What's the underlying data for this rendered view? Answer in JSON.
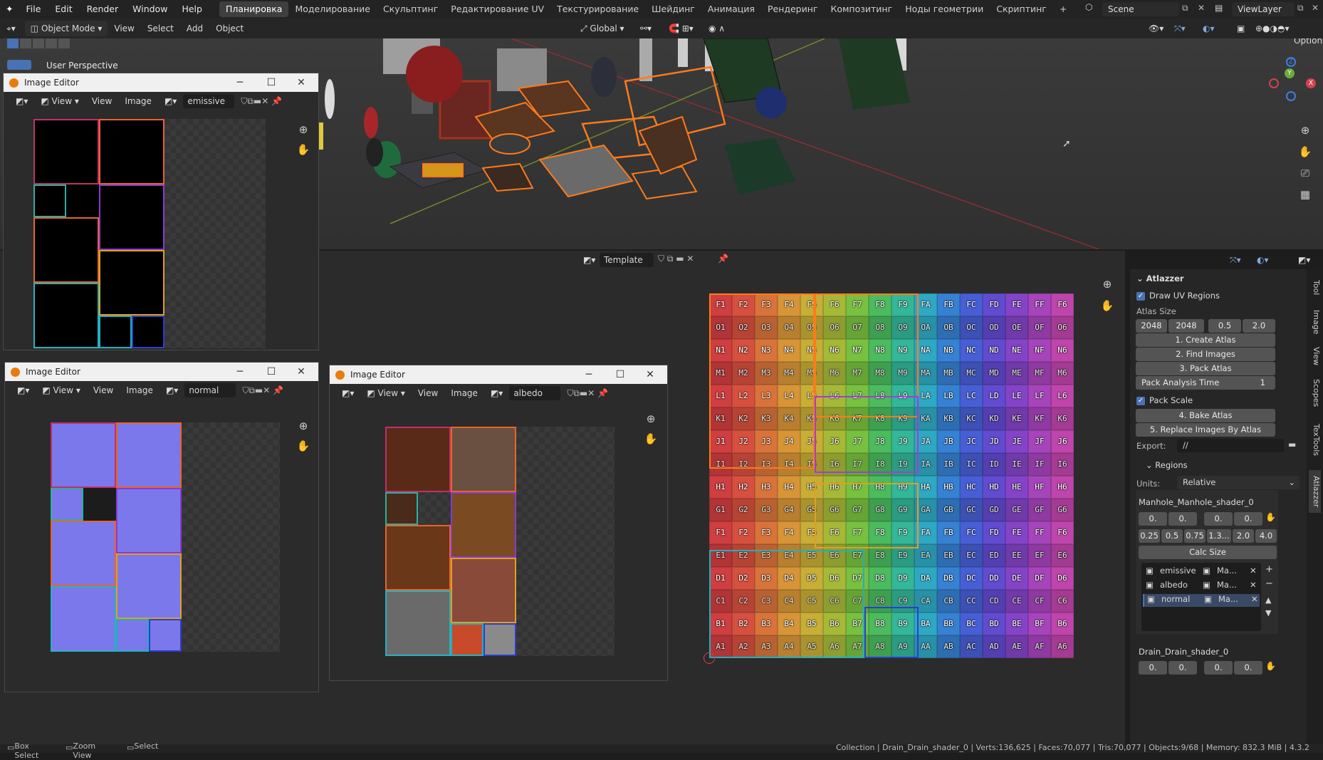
{
  "topbar": {
    "menus": [
      "File",
      "Edit",
      "Render",
      "Window",
      "Help"
    ],
    "workspaces": [
      "Планировка",
      "Моделирование",
      "Скульптинг",
      "Редактирование UV",
      "Текстурирование",
      "Шейдинг",
      "Анимация",
      "Рендеринг",
      "Композитинг",
      "Ноды геометрии",
      "Скриптинг"
    ],
    "active_workspace": "Планировка",
    "scene": "Scene",
    "view_layer": "ViewLayer"
  },
  "viewport_header": {
    "mode": "Object Mode",
    "menus": [
      "View",
      "Select",
      "Add",
      "Object"
    ],
    "transform": "Global",
    "options": "Options",
    "perspective_label": "User Perspective"
  },
  "image_editor_header": {
    "image_name": "Template"
  },
  "windows": [
    {
      "title": "Image Editor",
      "image": "emissive",
      "view": "View",
      "menu_view": "View",
      "menu_image": "Image"
    },
    {
      "title": "Image Editor",
      "image": "normal",
      "view": "View",
      "menu_view": "View",
      "menu_image": "Image"
    },
    {
      "title": "Image Editor",
      "image": "albedo",
      "view": "View",
      "menu_view": "View",
      "menu_image": "Image"
    }
  ],
  "uv_grid": {
    "rows": [
      [
        "F1",
        "F2",
        "F3",
        "F4",
        "F5",
        "F6",
        "F7",
        "F8",
        "F9",
        "FA",
        "FB",
        "FC",
        "FD",
        "FE",
        "FF",
        "F6"
      ],
      [
        "O1",
        "O2",
        "O3",
        "O4",
        "O5",
        "O6",
        "O7",
        "O8",
        "O9",
        "OA",
        "OB",
        "OC",
        "OD",
        "OE",
        "OF",
        "O6"
      ],
      [
        "N1",
        "N2",
        "N3",
        "N4",
        "N5",
        "N6",
        "N7",
        "N8",
        "N9",
        "NA",
        "NB",
        "NC",
        "ND",
        "NE",
        "NF",
        "N6"
      ],
      [
        "M1",
        "M2",
        "M3",
        "M4",
        "M5",
        "M6",
        "M7",
        "M8",
        "M9",
        "MA",
        "MB",
        "MC",
        "MD",
        "ME",
        "MF",
        "M6"
      ],
      [
        "L1",
        "L2",
        "L3",
        "L4",
        "L5",
        "L6",
        "L7",
        "L8",
        "L9",
        "LA",
        "LB",
        "LC",
        "LD",
        "LE",
        "LF",
        "L6"
      ],
      [
        "K1",
        "K2",
        "K3",
        "K4",
        "K5",
        "K6",
        "K7",
        "K8",
        "K9",
        "KA",
        "KB",
        "KC",
        "KD",
        "KE",
        "KF",
        "K6"
      ],
      [
        "J1",
        "J2",
        "J3",
        "J4",
        "J5",
        "J6",
        "J7",
        "J8",
        "J9",
        "JA",
        "JB",
        "JC",
        "JD",
        "JE",
        "JF",
        "J6"
      ],
      [
        "I1",
        "I2",
        "I3",
        "I4",
        "I5",
        "I6",
        "I7",
        "I8",
        "I9",
        "IA",
        "IB",
        "IC",
        "ID",
        "IE",
        "IF",
        "I6"
      ],
      [
        "H1",
        "H2",
        "H3",
        "H4",
        "H5",
        "H6",
        "H7",
        "H8",
        "H9",
        "HA",
        "HB",
        "HC",
        "HD",
        "HE",
        "HF",
        "H6"
      ],
      [
        "G1",
        "G2",
        "G3",
        "G4",
        "G5",
        "G6",
        "G7",
        "G8",
        "G9",
        "GA",
        "GB",
        "GC",
        "GD",
        "GE",
        "GF",
        "G6"
      ],
      [
        "F1",
        "F2",
        "F3",
        "F4",
        "F5",
        "F6",
        "F7",
        "F8",
        "F9",
        "FA",
        "FB",
        "FC",
        "FD",
        "FE",
        "FF",
        "F6"
      ],
      [
        "E1",
        "E2",
        "E3",
        "E4",
        "E5",
        "E6",
        "E7",
        "E8",
        "E9",
        "EA",
        "EB",
        "EC",
        "ED",
        "EE",
        "EF",
        "E6"
      ],
      [
        "D1",
        "D2",
        "D3",
        "D4",
        "D5",
        "D6",
        "D7",
        "D8",
        "D9",
        "DA",
        "DB",
        "DC",
        "DD",
        "DE",
        "DF",
        "D6"
      ],
      [
        "C1",
        "C2",
        "C3",
        "C4",
        "C5",
        "C6",
        "C7",
        "C8",
        "C9",
        "CA",
        "CB",
        "CC",
        "CD",
        "CE",
        "CF",
        "C6"
      ],
      [
        "B1",
        "B2",
        "B3",
        "B4",
        "B5",
        "B6",
        "B7",
        "B8",
        "B9",
        "BA",
        "BB",
        "BC",
        "BD",
        "BE",
        "BF",
        "B6"
      ],
      [
        "A1",
        "A2",
        "A3",
        "A4",
        "A5",
        "A6",
        "A7",
        "A8",
        "A9",
        "AA",
        "AB",
        "AC",
        "AD",
        "AE",
        "AF",
        "A6"
      ]
    ],
    "column_colors": [
      "#c0393b",
      "#c64a3a",
      "#c86b36",
      "#c78a33",
      "#b9a033",
      "#9aab33",
      "#6fb23b",
      "#45ad57",
      "#2fa98d",
      "#2b9cb5",
      "#3277c2",
      "#4257c4",
      "#5a45c0",
      "#7a3fb8",
      "#9a3fae",
      "#b0409e"
    ]
  },
  "sidebar": {
    "tabs": [
      "Tool",
      "Image",
      "View",
      "Scopes",
      "TexTools",
      "Atlazzer"
    ],
    "panel_title": "Atlazzer",
    "draw_uv_regions": "Draw UV Regions",
    "atlas_size_label": "Atlas Size",
    "atlas_values": [
      "2048",
      "2048",
      "0.5",
      "2.0"
    ],
    "create_atlas": "1. Create Atlas",
    "find_images": "2. Find Images",
    "pack_atlas": "3. Pack Atlas",
    "pack_analysis_time": "Pack Analysis Time",
    "pack_analysis_value": "1",
    "pack_scale": "Pack Scale",
    "bake_atlas": "4. Bake Atlas",
    "replace_images": "5. Replace Images By Atlas",
    "export_label": "Export:",
    "export_value": "//",
    "regions_label": "Regions",
    "units_label": "Units:",
    "units_value": "Relative",
    "shader1": "Manhole_Manhole_shader_0",
    "shader1_row1": [
      "0.",
      "0.",
      "0.",
      "0."
    ],
    "shader1_row2": [
      "0.25",
      "0.5",
      "0.75",
      "1.3...",
      "2.0",
      "4.0"
    ],
    "calc_size": "Calc Size",
    "list": [
      {
        "name": "emissive",
        "mat": "Ma..."
      },
      {
        "name": "albedo",
        "mat": "Ma..."
      },
      {
        "name": "normal",
        "mat": "Ma..."
      }
    ],
    "shader2": "Drain_Drain_shader_0",
    "shader2_row1": [
      "0.",
      "0.",
      "0.",
      "0."
    ]
  },
  "statusbar": {
    "box_select": "Box Select",
    "zoom_view": "Zoom View",
    "select": "Select",
    "info": "Collection | Drain_Drain_shader_0 | Verts:136,625 | Faces:70,077 | Tris:70,077 | Objects:9/68 | Memory: 832.3 MiB | 4.3.2"
  },
  "colors": {
    "accent": "#4772b3",
    "selection_orange": "#ff7a1a"
  }
}
